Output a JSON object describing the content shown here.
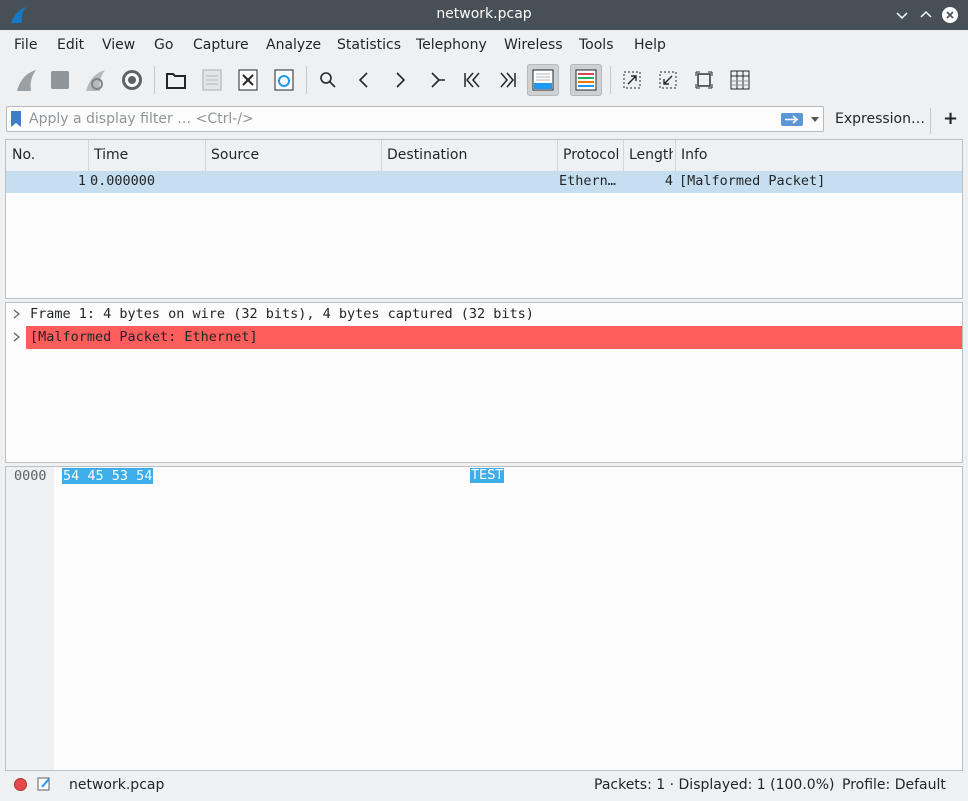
{
  "window": {
    "title": "network.pcap"
  },
  "menu": [
    "File",
    "Edit",
    "View",
    "Go",
    "Capture",
    "Analyze",
    "Statistics",
    "Telephony",
    "Wireless",
    "Tools",
    "Help"
  ],
  "toolbar": {
    "icons": [
      "shark-fin-start-icon",
      "stop-square-icon",
      "restart-capture-icon",
      "capture-options-gear-icon",
      "open-folder-icon",
      "save-file-icon",
      "close-file-icon",
      "reload-file-icon",
      "find-packet-icon",
      "go-back-icon",
      "go-forward-icon",
      "go-to-packet-icon",
      "first-packet-icon",
      "last-packet-icon",
      "auto-scroll-icon",
      "colorize-icon",
      "zoom-in-icon",
      "zoom-out-icon",
      "normal-size-icon",
      "resize-columns-icon"
    ]
  },
  "filter": {
    "placeholder": "Apply a display filter … <Ctrl-/>",
    "expression_label": "Expression…",
    "add_label": "+"
  },
  "packet_list": {
    "columns": [
      "No.",
      "Time",
      "Source",
      "Destination",
      "Protocol",
      "Length",
      "Info"
    ],
    "rows": [
      {
        "no": "1",
        "time": "0.000000",
        "source": "",
        "destination": "",
        "protocol": "Ethern…",
        "length": "4",
        "info": "[Malformed Packet]"
      }
    ]
  },
  "details": {
    "items": [
      {
        "text": "Frame 1: 4 bytes on wire (32 bits), 4 bytes captured (32 bits)",
        "error": false
      },
      {
        "text": "[Malformed Packet: Ethernet]",
        "error": true
      }
    ]
  },
  "bytes": {
    "offset": "0000",
    "hex": "54 45 53 54",
    "ascii": "TEST"
  },
  "status": {
    "file": "network.pcap",
    "packets": "Packets: 1 · Displayed: 1 (100.0%)",
    "profile": "Profile: Default"
  },
  "colors": {
    "titlebar": "#475057",
    "selection": "#3daee9",
    "row_selected": "#c5dff1",
    "malformed": "#ff5c5c"
  }
}
